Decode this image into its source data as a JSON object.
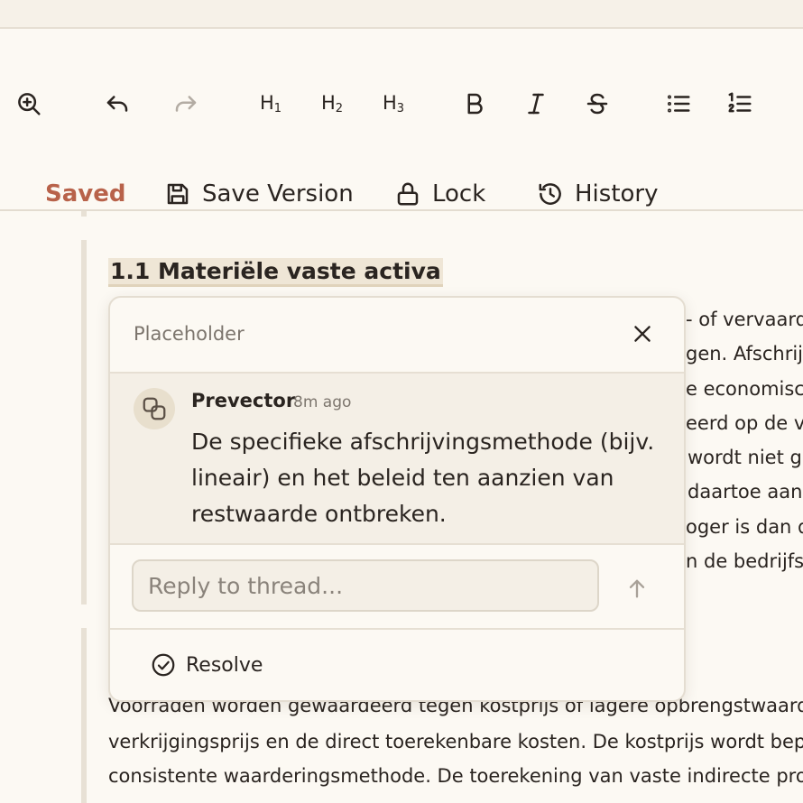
{
  "toolbar": {
    "headings": [
      {
        "main": "H",
        "sub": "1"
      },
      {
        "main": "H",
        "sub": "2"
      },
      {
        "main": "H",
        "sub": "3"
      }
    ],
    "actions": {
      "saved": "Saved",
      "save_version": "Save Version",
      "lock": "Lock",
      "history": "History"
    }
  },
  "document": {
    "heading": "1.1 Materiële vaste activa",
    "right_fragments": [
      "- of vervaardi",
      "gen. Afschrijv",
      "e economisch",
      "eerd op de ve",
      "wordt niet ge",
      "daartoe aanw",
      "oger is dan de",
      "n de bedrijfs"
    ],
    "bottom_lines": [
      "Voorraden worden gewaardeerd tegen kostprijs of lagere opbrengstwaarde",
      "verkrijgingsprijs en de direct toerekenbare kosten. De kostprijs wordt bepa",
      "consistente waarderingsmethode. De toerekening van vaste indirecte prod"
    ]
  },
  "comment_popup": {
    "placeholder": "Placeholder",
    "author": "Prevector",
    "time": "8m ago",
    "text": "De specifieke afschrijvingsmethode (bijv. lineair) en het beleid ten aanzien van restwaarde ontbreken.",
    "reply_placeholder": "Reply to thread...",
    "resolve_label": "Resolve"
  },
  "colors": {
    "accent_saved": "#b8624a",
    "background": "#fcf9f3",
    "comment_bg": "#f4efe6",
    "heading_highlight": "#efe6d6"
  }
}
